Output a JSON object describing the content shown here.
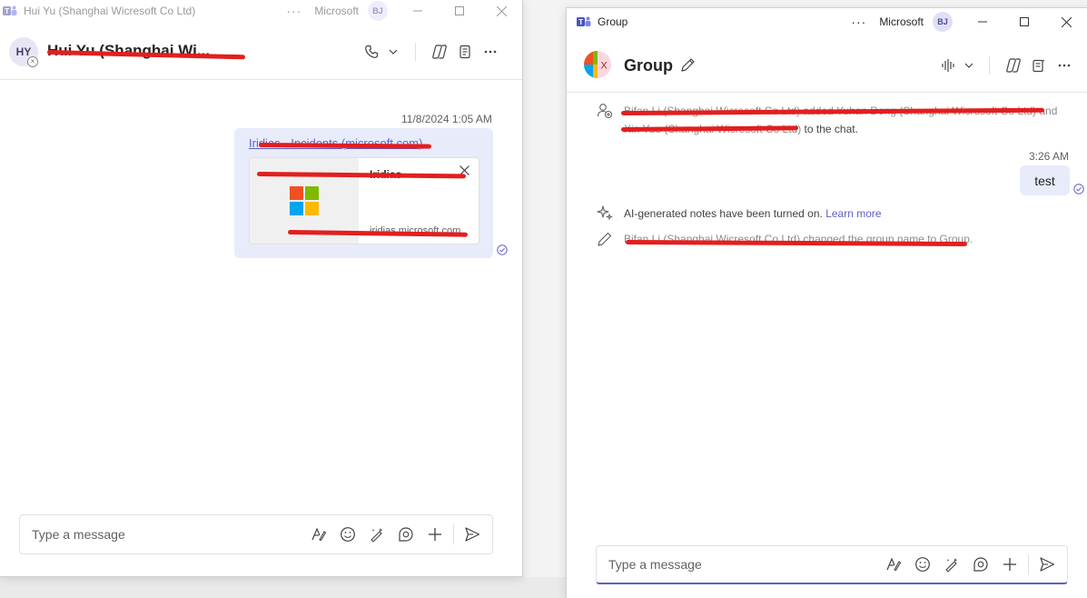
{
  "left_window": {
    "title": "Hui Yu (Shanghai Wicresoft Co Ltd)",
    "org": "Microsoft",
    "user_initials": "BJ",
    "contact_initials": "HY",
    "contact_name": "Hui Yu (Shanghai Wi...",
    "message": {
      "timestamp": "11/8/2024 1:05 AM",
      "link_text": "Iridias - Incidents (microsoft.com)",
      "card_title": "Iridias",
      "card_domain": "iridias.microsoft.com"
    },
    "composer_placeholder": "Type a message"
  },
  "right_window": {
    "title": "Group",
    "org": "Microsoft",
    "user_initials": "BJ",
    "group_name": "Group",
    "group_avatar_letter": "X",
    "system_messages": {
      "added_part1": "Bifan Li (Shanghai Wicresoft Co Ltd) added Yuhan Deng (Shanghai Wicresoft Co Ltd) and",
      "added_part2_struck": "Xin Yue (Shanghai Wicresoft Co Ltd)",
      "added_part2_rest": " to the chat.",
      "ai_notes": "AI-generated notes have been turned on.",
      "learn_more": "Learn more",
      "renamed": "Bifan Li (Shanghai Wicresoft Co Ltd) changed the group name to Group."
    },
    "message": {
      "timestamp": "3:26 AM",
      "text": "test"
    },
    "composer_placeholder": "Type a message"
  },
  "icons": [
    "teams-icon",
    "call-icon",
    "chevron-down-icon",
    "copilot-icon",
    "notes-icon",
    "more-icon",
    "minimize-icon",
    "maximize-icon",
    "close-icon",
    "audio-call-icon",
    "format-icon",
    "emoji-icon",
    "sticker-icon",
    "loop-icon",
    "plus-icon",
    "send-icon",
    "edit-icon",
    "add-person-icon",
    "sparkle-icon",
    "seen-icon"
  ],
  "colors": {
    "accent": "#5b5fc7",
    "bubble": "#e8ebfa",
    "redaction": "#e41e1e"
  }
}
